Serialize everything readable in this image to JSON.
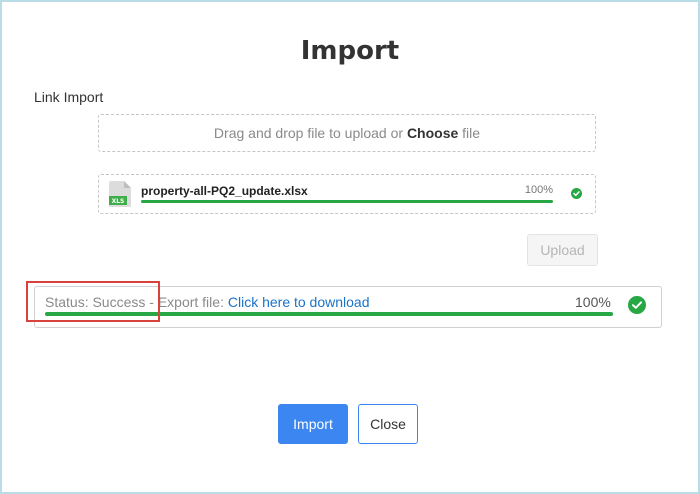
{
  "dialog": {
    "title": "Import",
    "section_label": "Link Import"
  },
  "dropzone": {
    "text_before": "Drag and drop file to upload or ",
    "choose_label": "Choose",
    "text_after": " file"
  },
  "file": {
    "icon": "xls-file-icon",
    "icon_label": "XLS",
    "name": "property-all-PQ2_update.xlsx",
    "progress_text": "100%",
    "progress_value": 100,
    "status_icon": "check-circle-icon"
  },
  "upload_button": {
    "label": "Upload",
    "disabled": true
  },
  "status": {
    "prefix": "Status: Success - Export file: ",
    "link_text": "Click here to download",
    "progress_text": "100%",
    "progress_value": 100,
    "status_icon": "check-circle-icon"
  },
  "footer": {
    "import_label": "Import",
    "close_label": "Close"
  },
  "colors": {
    "accent": "#3b86f0",
    "success": "#28a745",
    "link": "#1a73c8",
    "highlight": "#d9413b",
    "frame": "#b9dde6"
  }
}
